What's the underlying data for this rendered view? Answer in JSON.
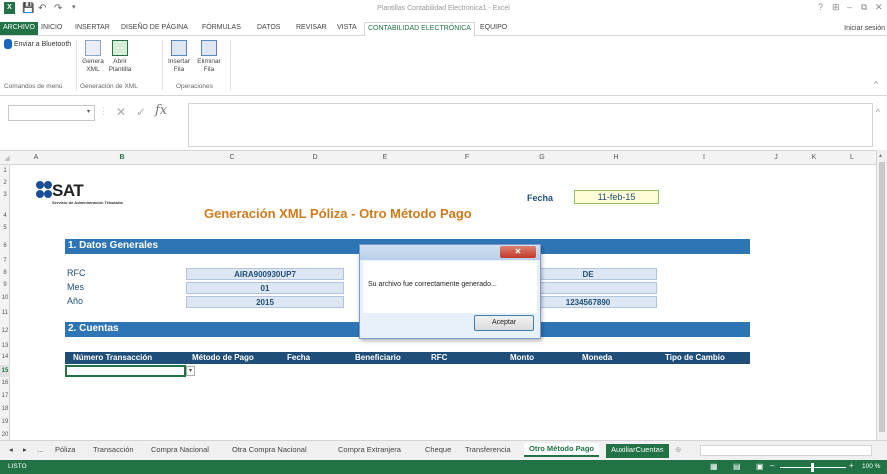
{
  "window": {
    "title": "Plantillas Contabilidad Electronica1 - Excel",
    "signin": "Iniciar sesión"
  },
  "qat": {
    "excel_icon": "excel-icon",
    "save_icon": "save-icon",
    "undo_icon": "undo-icon",
    "redo_icon": "redo-icon",
    "customize": "▾"
  },
  "window_controls": {
    "help": "?",
    "restore_ribbon": "⊞",
    "minimize": "–",
    "maximize": "⧉",
    "close": "✕"
  },
  "tabs": [
    "ARCHIVO",
    "INICIO",
    "INSERTAR",
    "DISEÑO DE PÁGINA",
    "FÓRMULAS",
    "DATOS",
    "REVISAR",
    "VISTA",
    "CONTABILIDAD ELECTRÓNICA",
    "EQUIPO"
  ],
  "ribbon": {
    "bluetooth": "Enviar a Bluetooth",
    "group_menu": "Comandos de menú",
    "generate_label": "Genera XML",
    "open_label": "Abrir Plantilla",
    "group_xml": "Generación de XML",
    "insert_label": "Insertar Fila",
    "delete_label": "Eliminar Fila",
    "group_ops": "Operaciones"
  },
  "formula_bar": {
    "namebox": "",
    "cancel": "✕",
    "enter": "✓",
    "fx": "fx",
    "value": ""
  },
  "columns": [
    "A",
    "B",
    "C",
    "D",
    "E",
    "F",
    "G",
    "H",
    "I",
    "J",
    "K",
    "L"
  ],
  "selected_column": "B",
  "rows": [
    "1",
    "2",
    "3",
    "4",
    "5",
    "6",
    "7",
    "8",
    "9",
    "10",
    "11",
    "12",
    "13",
    "14",
    "15",
    "16",
    "17",
    "18",
    "19",
    "20"
  ],
  "selected_row": "15",
  "sheet": {
    "sat_word": "SAT",
    "sat_sub": "Servicio de Administración Tributaria",
    "doc_title": "Generación XML Póliza - Otro Método Pago",
    "fecha_label": "Fecha",
    "fecha_value": "11-feb-15",
    "section1": "1. Datos Generales",
    "rfc_label": "RFC",
    "rfc_value": "AIRA900930UP7",
    "mes_label": "Mes",
    "mes_value": "01",
    "anio_label": "Año",
    "anio_value": "2015",
    "right_value_1": "DE",
    "right_value_3": "1234567890",
    "section2": "2. Cuentas",
    "headers": [
      "Número Transacción",
      "Método de Pago",
      "Fecha",
      "Beneficiario",
      "RFC",
      "Monto",
      "Moneda",
      "Tipo de Cambio"
    ]
  },
  "dialog": {
    "close": "✕",
    "message": "Su archivo fue correctamente generado...",
    "ok": "Aceptar"
  },
  "sheet_tabs": {
    "nav_prev": "◂",
    "nav_next": "▸",
    "more_left": "...",
    "tabs": [
      "Póliza",
      "Transacción",
      "Compra Nacional",
      "Otra Compra Nacional",
      "Compra Extranjera",
      "Cheque",
      "Transferencia",
      "Otro Método Pago",
      "AuxiliarCuentas"
    ],
    "active": "Otro Método Pago",
    "more_right": "...",
    "add_sheet": "⊕"
  },
  "status": {
    "ready": "LISTO",
    "zoom": "100 %"
  }
}
